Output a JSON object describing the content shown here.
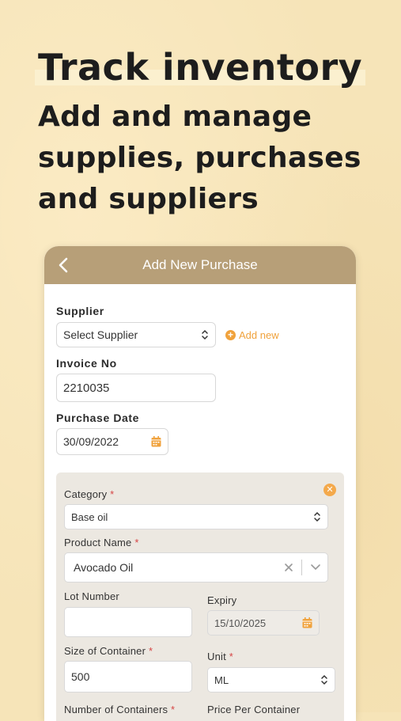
{
  "headline": {
    "title": "Track inventory",
    "subtitle_lines": [
      "Add and manage",
      "supplies, purchases",
      "and suppliers"
    ]
  },
  "nav": {
    "title": "Add New Purchase",
    "back_icon": "chevron-left-icon"
  },
  "form": {
    "supplier": {
      "label": "Supplier",
      "value": "Select Supplier",
      "add_new": "Add new"
    },
    "invoice": {
      "label": "Invoice No",
      "value": "2210035"
    },
    "purchase_date": {
      "label": "Purchase Date",
      "value": "30/09/2022"
    }
  },
  "item": {
    "category": {
      "label": "Category",
      "required": "*",
      "value": "Base oil"
    },
    "product": {
      "label": "Product Name",
      "required": "*",
      "value": "Avocado Oil"
    },
    "lot": {
      "label": "Lot Number",
      "value": ""
    },
    "expiry": {
      "label": "Expiry",
      "value": "15/10/2025"
    },
    "size": {
      "label": "Size of Container",
      "required": "*",
      "value": "500"
    },
    "unit": {
      "label": "Unit",
      "required": "*",
      "value": "ML"
    },
    "num_containers": {
      "label": "Number of Containers",
      "required": "*"
    },
    "price": {
      "label": "Price Per Container"
    }
  },
  "colors": {
    "accent": "#f0a23c",
    "nav": "#b79f78",
    "background": "#f6e4b8"
  }
}
